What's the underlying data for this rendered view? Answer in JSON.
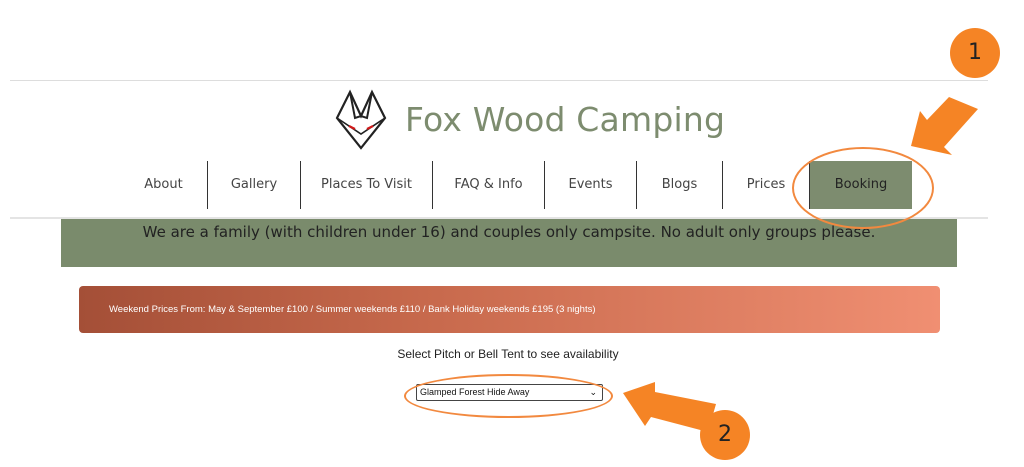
{
  "site": {
    "title": "Fox Wood Camping"
  },
  "nav": [
    {
      "label": "About"
    },
    {
      "label": "Gallery"
    },
    {
      "label": "Places To Visit"
    },
    {
      "label": "FAQ & Info"
    },
    {
      "label": "Events"
    },
    {
      "label": "Blogs"
    },
    {
      "label": "Prices"
    },
    {
      "label": "Booking",
      "active": true
    }
  ],
  "notice": {
    "text": "We are a family (with children under 16) and couples only campsite. No adult only groups please."
  },
  "prices_banner": {
    "text": "Weekend Prices From: May & September £100 / Summer weekends £110 / Bank Holiday weekends £195 (3 nights)"
  },
  "availability": {
    "label": "Select Pitch or Bell Tent to see availability",
    "selected": "Glamped Forest Hide Away"
  },
  "annotations": {
    "badge_1": "1",
    "badge_2": "2",
    "color": "#f58425"
  },
  "colors": {
    "brand_green": "#7d8c6f",
    "notice_green": "#7a8b6c",
    "banner_start": "#a44f37",
    "banner_end": "#f08f72"
  }
}
